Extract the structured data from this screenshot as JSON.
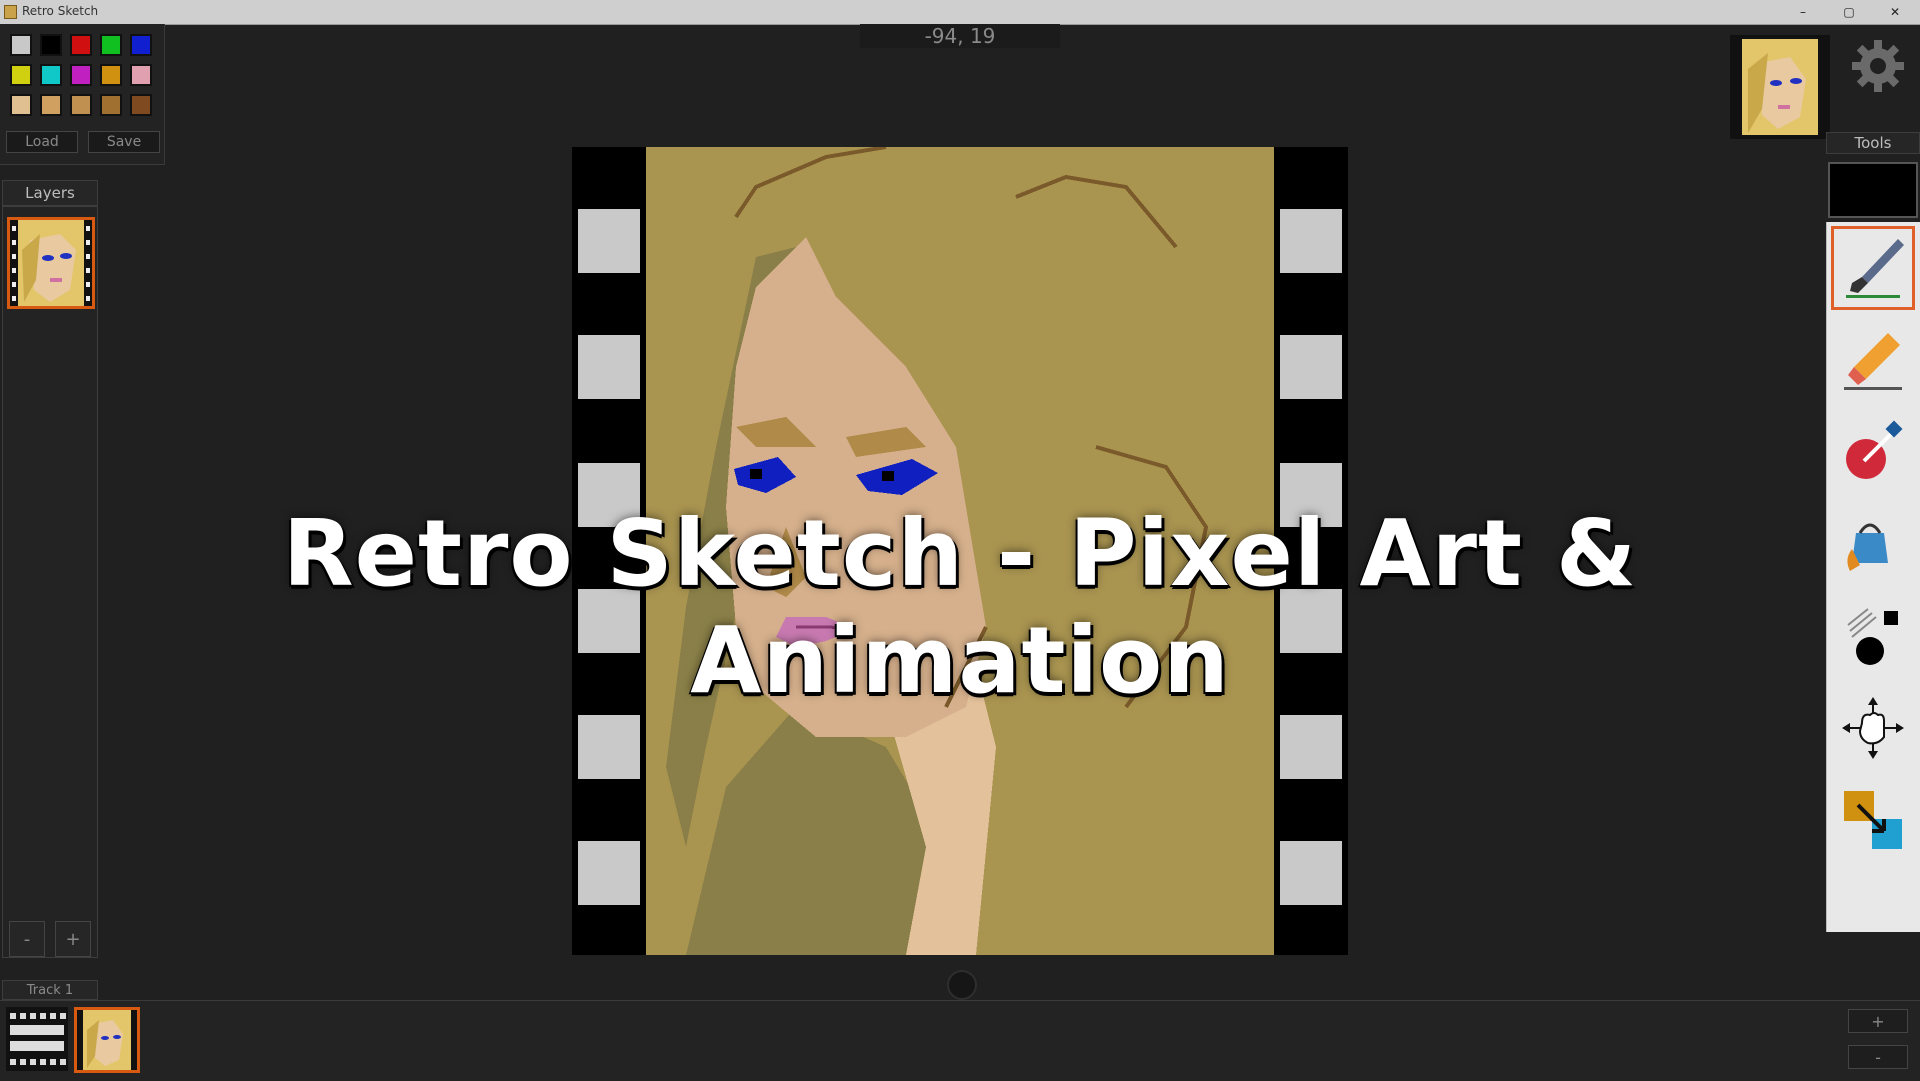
{
  "window": {
    "title": "Retro Sketch",
    "minimize": "–",
    "maximize": "▢",
    "close": "✕"
  },
  "palette": {
    "colors": [
      "#c8c8c8",
      "#000000",
      "#d01010",
      "#10c020",
      "#1020d0",
      "#d0d010",
      "#10c8c8",
      "#c020c0",
      "#d09010",
      "#e0a0b0",
      "#e0c090",
      "#d0a060",
      "#c09050",
      "#a07030",
      "#804a20"
    ],
    "load_label": "Load",
    "save_label": "Save"
  },
  "layers": {
    "header": "Layers",
    "remove_label": "-",
    "add_label": "+"
  },
  "coords": {
    "text": "-94, 19"
  },
  "tools": {
    "header": "Tools",
    "items": [
      "brush",
      "eraser",
      "eyedropper",
      "bucket-fill",
      "shape",
      "move",
      "swap-colors"
    ],
    "selected": "brush"
  },
  "track": {
    "label": "Track 1",
    "add_label": "+",
    "remove_label": "-"
  },
  "overlay": {
    "title": "Retro Sketch - Pixel Art & Animation"
  },
  "colors": {
    "accent": "#d85a10",
    "background": "#202020",
    "canvas": "#a99450"
  }
}
